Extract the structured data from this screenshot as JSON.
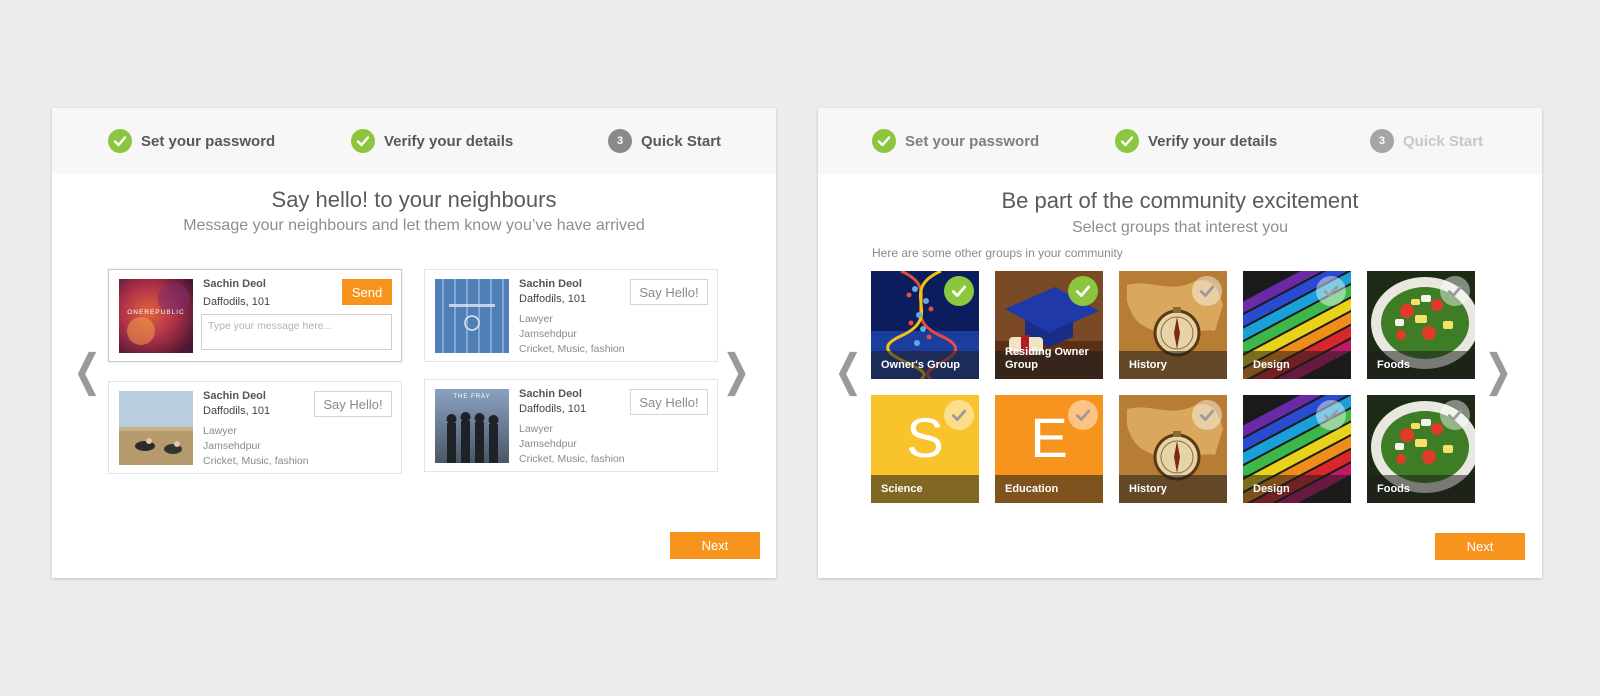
{
  "left_panel": {
    "steps": [
      {
        "label": "Set your password",
        "state": "done"
      },
      {
        "label": "Verify your details",
        "state": "done"
      },
      {
        "label": "Quick Start",
        "number": "3",
        "state": "current"
      }
    ],
    "title": "Say hello! to your neighbours",
    "subtitle": "Message your neighbours and let them know you’ve have arrived",
    "cards": [
      {
        "name": "Sachin Deol",
        "flat": "Daffodils, 101",
        "action_label": "Send",
        "message_placeholder": "Type your message here...",
        "cover_text": "ONEREPUBLIC"
      },
      {
        "name": "Sachin Deol",
        "flat": "Daffodils, 101",
        "profession": "Lawyer",
        "city": "Jamsehdpur",
        "interests": "Cricket, Music, fashion",
        "action_label": "Say Hello!"
      },
      {
        "name": "Sachin Deol",
        "flat": "Daffodils, 101",
        "profession": "Lawyer",
        "city": "Jamsehdpur",
        "interests": "Cricket, Music, fashion",
        "action_label": "Say Hello!"
      },
      {
        "name": "Sachin Deol",
        "flat": "Daffodils, 101",
        "profession": "Lawyer",
        "city": "Jamsehdpur",
        "interests": "Cricket, Music, fashion",
        "action_label": "Say Hello!",
        "cover_text": "THE FRAY"
      }
    ],
    "prev_arrow": "❮",
    "next_arrow": "❯",
    "next_label": "Next"
  },
  "right_panel": {
    "steps": [
      {
        "label": "Set your password",
        "state": "done"
      },
      {
        "label": "Verify your details",
        "state": "done"
      },
      {
        "label": "Quick Start",
        "number": "3",
        "state": "upcoming"
      }
    ],
    "title": "Be part of the community excitement",
    "subtitle": "Select groups that interest you",
    "groups_note": "Here are some other groups in your community",
    "groups": [
      {
        "label": "Owner's Group",
        "selected": true,
        "theme": "dna"
      },
      {
        "label": "Residing Owner Group",
        "selected": true,
        "theme": "graduation"
      },
      {
        "label": "History",
        "selected": false,
        "theme": "history"
      },
      {
        "label": "Design",
        "selected": false,
        "theme": "design"
      },
      {
        "label": "Foods",
        "selected": false,
        "theme": "foods"
      },
      {
        "label": "Science",
        "selected": false,
        "theme": "letter",
        "letter": "S",
        "color": "#f9c32b"
      },
      {
        "label": "Education",
        "selected": false,
        "theme": "letter",
        "letter": "E",
        "color": "#f7941d"
      },
      {
        "label": "History",
        "selected": false,
        "theme": "history"
      },
      {
        "label": "Design",
        "selected": false,
        "theme": "design"
      },
      {
        "label": "Foods",
        "selected": false,
        "theme": "foods"
      }
    ],
    "prev_arrow": "❮",
    "next_arrow": "❯",
    "next_label": "Next"
  },
  "colors": {
    "accent": "#f7941d",
    "success": "#8cc63f",
    "background": "#ececec"
  }
}
